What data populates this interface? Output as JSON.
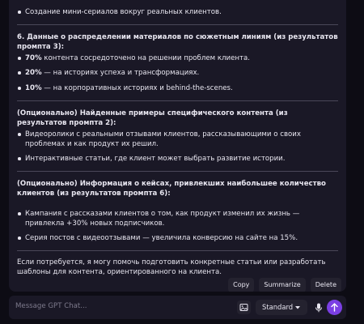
{
  "message": {
    "intro_bullet": "Создание мини-сериалов вокруг реальных клиентов.",
    "section6": {
      "heading": "6. Данные о распределении материалов по сюжетным линиям (из результатов промпта 3):",
      "items": [
        {
          "pct": "70%",
          "text": " контента сосредоточено на решении проблем клиента."
        },
        {
          "pct": "20%",
          "text": " — на историях успеха и трансформациях."
        },
        {
          "pct": "10%",
          "text": " — на корпоративных историях и behind-the-scenes."
        }
      ]
    },
    "section_examples": {
      "heading": "(Опционально) Найденные примеры специфического контента (из результатов промпта 2):",
      "items": [
        "Видеоролики с реальными отзывами клиентов, рассказывающими о своих проблемах и как продукт их решил.",
        "Интерактивные статьи, где клиент может выбрать развитие истории."
      ]
    },
    "section_cases": {
      "heading": "(Опционально) Информация о кейсах, привлекших наибольшее количество клиентов (из результатов промпта 6):",
      "items": [
        "Кампания с рассказами клиентов о том, как продукт изменил их жизнь — привлекла +30% новых подписчиков.",
        "Серия постов с видеоотзывами — увеличила конверсию на сайте на 15%."
      ]
    },
    "closing": "Если потребуется, я могу помочь подготовить конкретные статьи или разработать шаблоны для контента, ориентированного на клиента."
  },
  "actions": {
    "copy": "Copy",
    "summarize": "Summarize",
    "delete": "Delete"
  },
  "composer": {
    "placeholder": "Message GPT Chat...",
    "model": "Standard",
    "icons": [
      "image-icon",
      "chevron-down-icon",
      "microphone-icon",
      "arrow-up-icon"
    ]
  },
  "colors": {
    "background": "#0d0c14",
    "panel": "#1a1826",
    "button": "#24222f",
    "accent": "#7b3fe4",
    "text": "#e8e6f0",
    "placeholder": "#7d7a8c"
  }
}
